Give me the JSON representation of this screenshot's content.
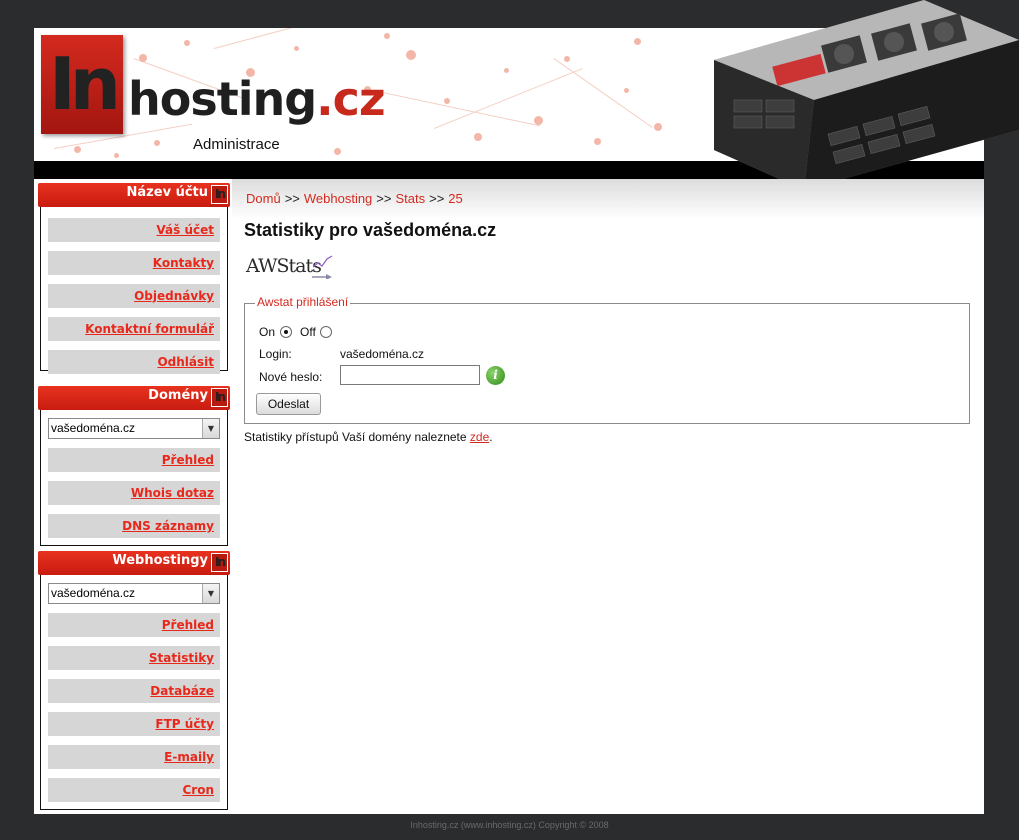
{
  "header": {
    "logo_in": "In",
    "logo_main": "hosting",
    "logo_tld": ".cz",
    "subtitle": "Administrace"
  },
  "sidebar": {
    "account": {
      "title": "Název účtu",
      "links": [
        "Váš účet",
        "Kontakty",
        "Objednávky",
        "Kontaktní formulář",
        "Odhlásit"
      ]
    },
    "domains": {
      "title": "Domény",
      "selected": "vašedoména.cz",
      "links": [
        "Přehled",
        "Whois dotaz",
        "DNS záznamy"
      ]
    },
    "webhosting": {
      "title": "Webhostingy",
      "selected": "vašedoména.cz",
      "links": [
        "Přehled",
        "Statistiky",
        "Databáze",
        "FTP účty",
        "E-maily",
        "Cron"
      ]
    }
  },
  "breadcrumb": {
    "items": [
      "Domů",
      "Webhosting",
      "Stats",
      "25"
    ],
    "separator": ">>"
  },
  "main": {
    "title": "Statistiky pro vašedoména.cz",
    "awstats_logo": "AWStats",
    "form": {
      "legend": "Awstat přihlášení",
      "on_label": "On",
      "off_label": "Off",
      "selected": "On",
      "login_label": "Login:",
      "login_value": "vašedoména.cz",
      "password_label": "Nové heslo:",
      "password_value": "",
      "submit_label": "Odeslat"
    },
    "note_prefix": "Statistiky přístupů Vaší domény naleznete",
    "note_link": "zde",
    "note_suffix": "."
  },
  "footer": {
    "text": "Inhosting.cz (www.inhosting.cz) Copyright © 2008"
  },
  "colors": {
    "accent": "#d42a1f",
    "background": "#2b2c2e",
    "sidebar_link_bg": "#d6d6d6"
  }
}
